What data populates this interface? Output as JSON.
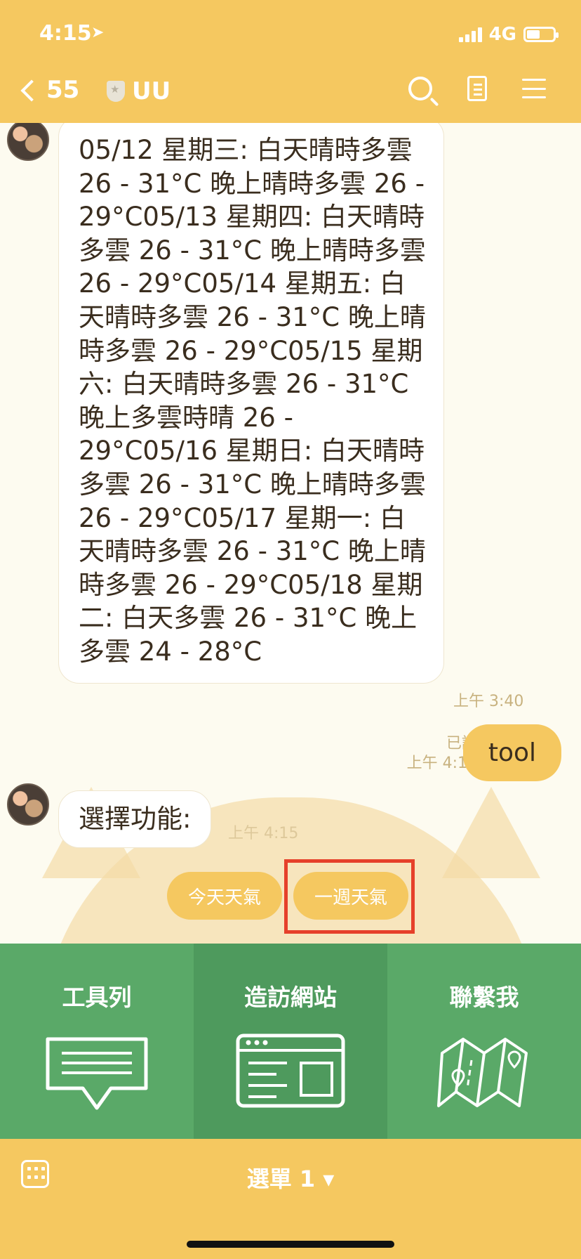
{
  "status_bar": {
    "time": "4:15",
    "network": "4G"
  },
  "header": {
    "back_count": "55",
    "title": "UU"
  },
  "chat": {
    "messages": [
      {
        "text": "05/12 星期三: 白天晴時多雲 26 - 31°C 晚上晴時多雲 26 - 29°C05/13 星期四: 白天晴時多雲 26 - 31°C 晚上晴時多雲 26 - 29°C05/14 星期五: 白天晴時多雲 26 - 31°C 晚上晴時多雲 26 - 29°C05/15 星期六: 白天晴時多雲 26 - 31°C 晚上多雲時晴 26 - 29°C05/16 星期日: 白天晴時多雲 26 - 31°C 晚上晴時多雲 26 - 29°C05/17 星期一: 白天晴時多雲 26 - 31°C 晚上晴時多雲 26 - 29°C05/18 星期二: 白天多雲 26 - 31°C 晚上多雲 24 - 28°C",
        "time": "上午 3:40"
      },
      {
        "text": "tool",
        "read": "已讀",
        "time": "上午 4:15"
      },
      {
        "text": "選擇功能:",
        "time": "上午 4:15"
      }
    ],
    "quick_replies": [
      "今天天氣",
      "一週天氣"
    ]
  },
  "rich_menu": [
    {
      "label": "工具列",
      "icon": "chat-bubble-icon"
    },
    {
      "label": "造訪網站",
      "icon": "browser-window-icon"
    },
    {
      "label": "聯繫我",
      "icon": "map-icon"
    }
  ],
  "bottom_bar": {
    "menu_label": "選單 1 ▾"
  },
  "colors": {
    "accent": "#f5c860",
    "menu_green": "#5aa968",
    "highlight": "#e6402a"
  }
}
